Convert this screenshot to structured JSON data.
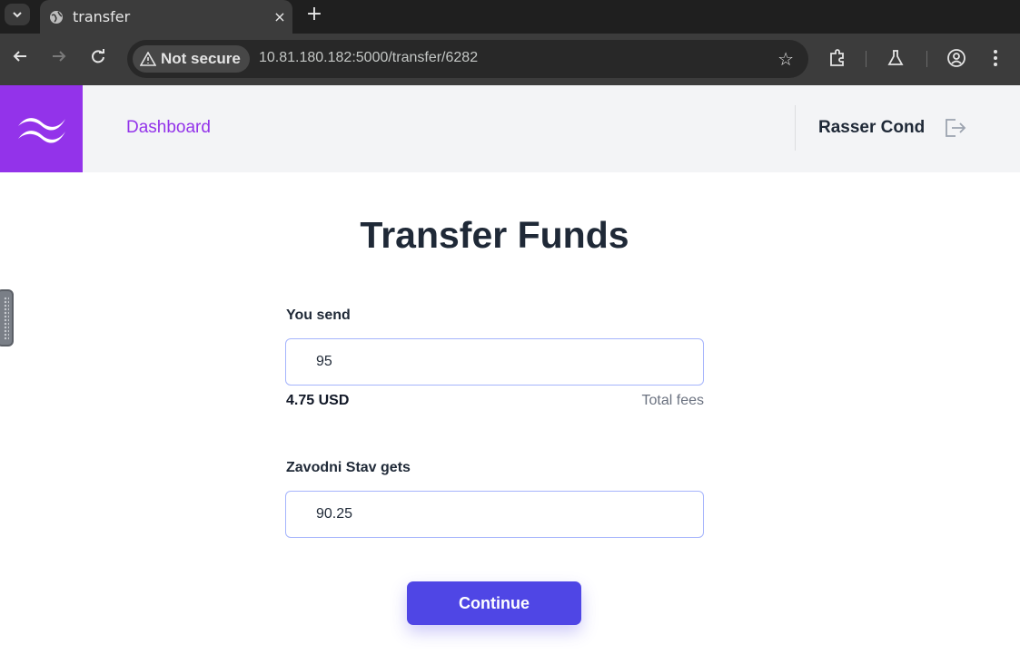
{
  "browser": {
    "tab_title": "transfer",
    "tab_close": "×",
    "new_tab": "+",
    "security_label": "Not secure",
    "url": "10.81.180.182:5000/transfer/6282"
  },
  "header": {
    "nav_dashboard": "Dashboard",
    "user_name": "Rasser Cond"
  },
  "page": {
    "title": "Transfer Funds"
  },
  "form": {
    "send_label": "You send",
    "send_value": "95",
    "fee_amount": "4.75 USD",
    "fee_label": "Total fees",
    "receive_label": "Zavodni Stav gets",
    "receive_value": "90.25",
    "continue_label": "Continue"
  },
  "colors": {
    "brand_purple": "#9333ea",
    "button_indigo": "#4f46e5",
    "input_border": "#a5b4fc"
  }
}
